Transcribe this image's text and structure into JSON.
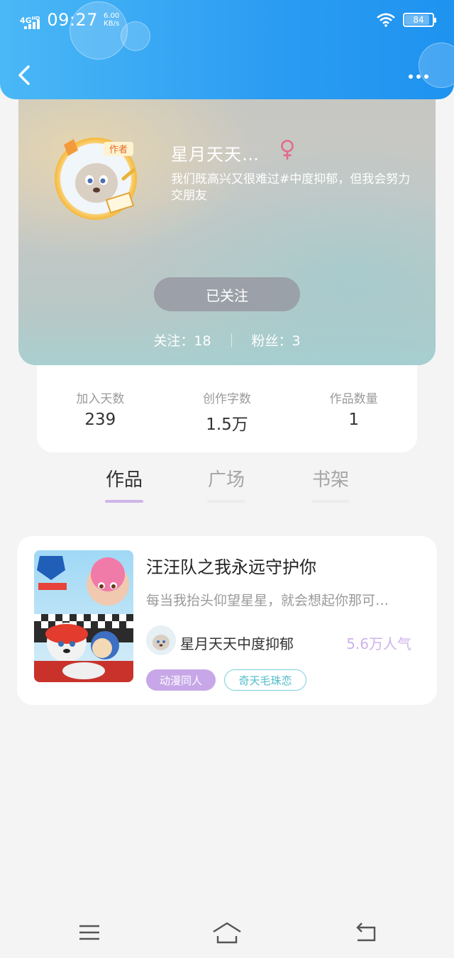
{
  "status_bar": {
    "network": "4G",
    "network_sup": "HD",
    "time": "09:27",
    "speed_value": "6.00",
    "speed_unit": "KB/s",
    "battery": "84"
  },
  "header": {
    "back_icon": "chevron-left-icon",
    "more_icon": "more-dots-icon"
  },
  "profile": {
    "avatar_badge": "作者",
    "name": "星月天天…",
    "gender_icon": "female-icon",
    "bio": "我们既高兴又很难过#中度抑郁，但我会努力交朋友",
    "follow_button": "已关注",
    "following": "关注：18",
    "followers": "粉丝：3"
  },
  "stats": [
    {
      "label": "加入天数",
      "value": "239"
    },
    {
      "label": "创作字数",
      "value": "1.5万"
    },
    {
      "label": "作品数量",
      "value": "1"
    }
  ],
  "tabs": [
    {
      "label": "作品",
      "active": true
    },
    {
      "label": "广场",
      "active": false
    },
    {
      "label": "书架",
      "active": false
    }
  ],
  "book": {
    "title": "汪汪队之我永远守护你",
    "description": "每当我抬头仰望星星，就会想起你那可…",
    "author": "星月天天中度抑郁",
    "popularity": "5.6万人气",
    "tags": [
      "动漫同人",
      "奇天毛珠恋"
    ]
  },
  "bottom_nav": {
    "menu_icon": "menu-icon",
    "home_icon": "home-icon",
    "back_icon": "return-icon"
  },
  "colors": {
    "header_blue": "#2b9cf2",
    "accent_purple": "#c7a7e8",
    "accent_teal": "#7cd0dc",
    "female_pink": "#e46a8a"
  }
}
